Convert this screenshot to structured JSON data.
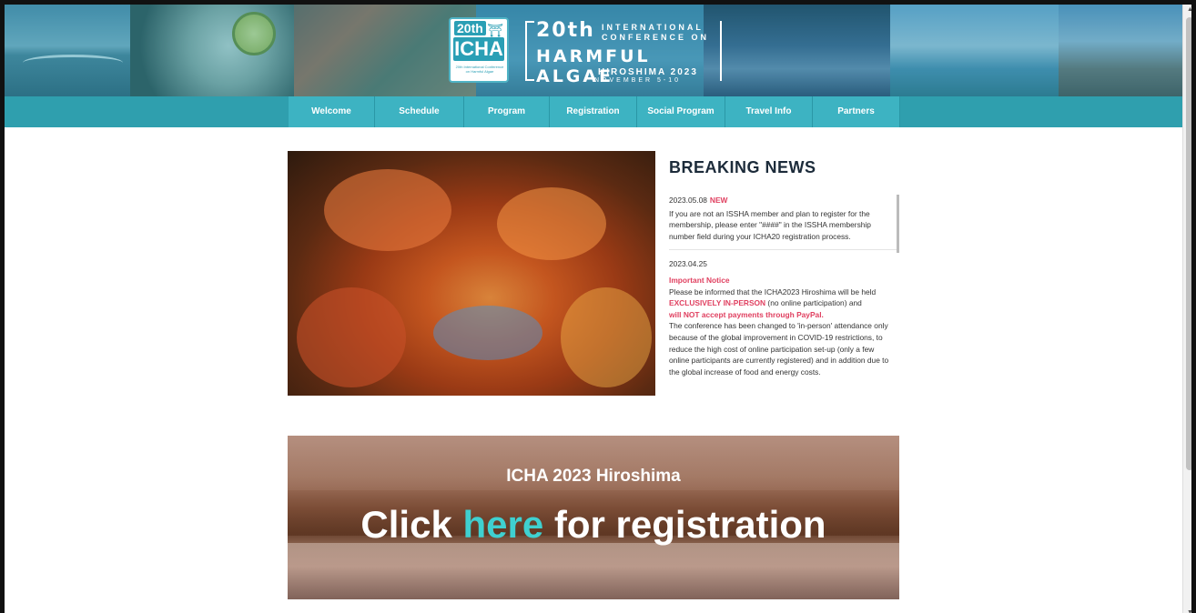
{
  "header": {
    "logo_badge": "20th",
    "logo_name": "ICHA",
    "logo_small": "20th International Conference on Harmful Algae",
    "conf_number": "20th",
    "conf_line1": "INTERNATIONAL",
    "conf_line2": "CONFERENCE ON",
    "conf_name": "HARMFUL ALGAE",
    "conf_place": "HIROSHIMA 2023",
    "conf_dates": "NOVEMBER 5-10"
  },
  "nav": {
    "items": [
      {
        "label": "Welcome"
      },
      {
        "label": "Schedule"
      },
      {
        "label": "Program"
      },
      {
        "label": "Registration"
      },
      {
        "label": "Social Program"
      },
      {
        "label": "Travel Info"
      },
      {
        "label": "Partners"
      }
    ]
  },
  "news": {
    "title": "BREAKING NEWS",
    "entry1": {
      "date": "2023.05.08",
      "badge": "NEW",
      "text": "If you are not an ISSHA member and plan to register for the membership, please enter \"####\" in the ISSHA membership number field during your ICHA20 registration process."
    },
    "entry2": {
      "date": "2023.04.25",
      "heading": "Important Notice",
      "text_a": "Please be informed that the ICHA2023 Hiroshima will be held ",
      "text_b": "EXCLUSIVELY IN-PERSON",
      "text_c": " (no online participation) and",
      "text_d": "will NOT accept payments through PayPal.",
      "text_e": "The conference has been changed to 'in-person' attendance only because of the global improvement in COVID-19 restrictions, to reduce the high cost of online participation set-up (only a few online participants are currently registered) and in addition due to the global increase of food and energy costs."
    }
  },
  "registration_banner": {
    "subtitle": "ICHA 2023 Hiroshima",
    "text_before": "Click ",
    "link": "here",
    "text_after": " for registration"
  },
  "colors": {
    "nav_bg": "#2f9fae",
    "nav_item": "#3db3c2",
    "accent_red": "#e04060",
    "link_cyan": "#3fd0d0"
  }
}
